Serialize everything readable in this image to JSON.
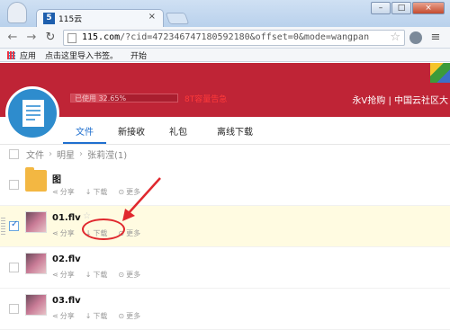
{
  "browser": {
    "tab_title": "115云",
    "tab_favicon": "5",
    "url_host": "115.com",
    "url_rest": "/?cid=472346747180592180&offset=0&mode=wangpan",
    "bookmarks": [
      "应用",
      "点击这里导入书签。",
      "开始"
    ]
  },
  "banner": {
    "usage_text": "已使用 32.65%",
    "usage_percent": 32.65,
    "usage_link": "8T容量告急",
    "right_text": "永V抢购 | 中国云社区大"
  },
  "tabs": [
    "文件",
    "新接收",
    "礼包",
    "离线下载"
  ],
  "breadcrumb": [
    "文件",
    "明星",
    "张莉滢(1)"
  ],
  "actions": {
    "share": "分享",
    "download": "下载",
    "more": "更多"
  },
  "files": [
    {
      "name": "图",
      "type": "folder",
      "selected": false
    },
    {
      "name": "01.flv",
      "type": "video",
      "selected": true
    },
    {
      "name": "02.flv",
      "type": "video",
      "selected": false
    },
    {
      "name": "03.flv",
      "type": "video",
      "selected": false
    }
  ],
  "colors": {
    "banner": "#bf2436",
    "accent": "#1f6fcf",
    "annotation": "#e0282e"
  },
  "icons": [
    "back-icon",
    "forward-icon",
    "reload-icon",
    "star-icon",
    "share-icon",
    "download-icon",
    "more-icon",
    "folder-icon",
    "doc-icon"
  ]
}
